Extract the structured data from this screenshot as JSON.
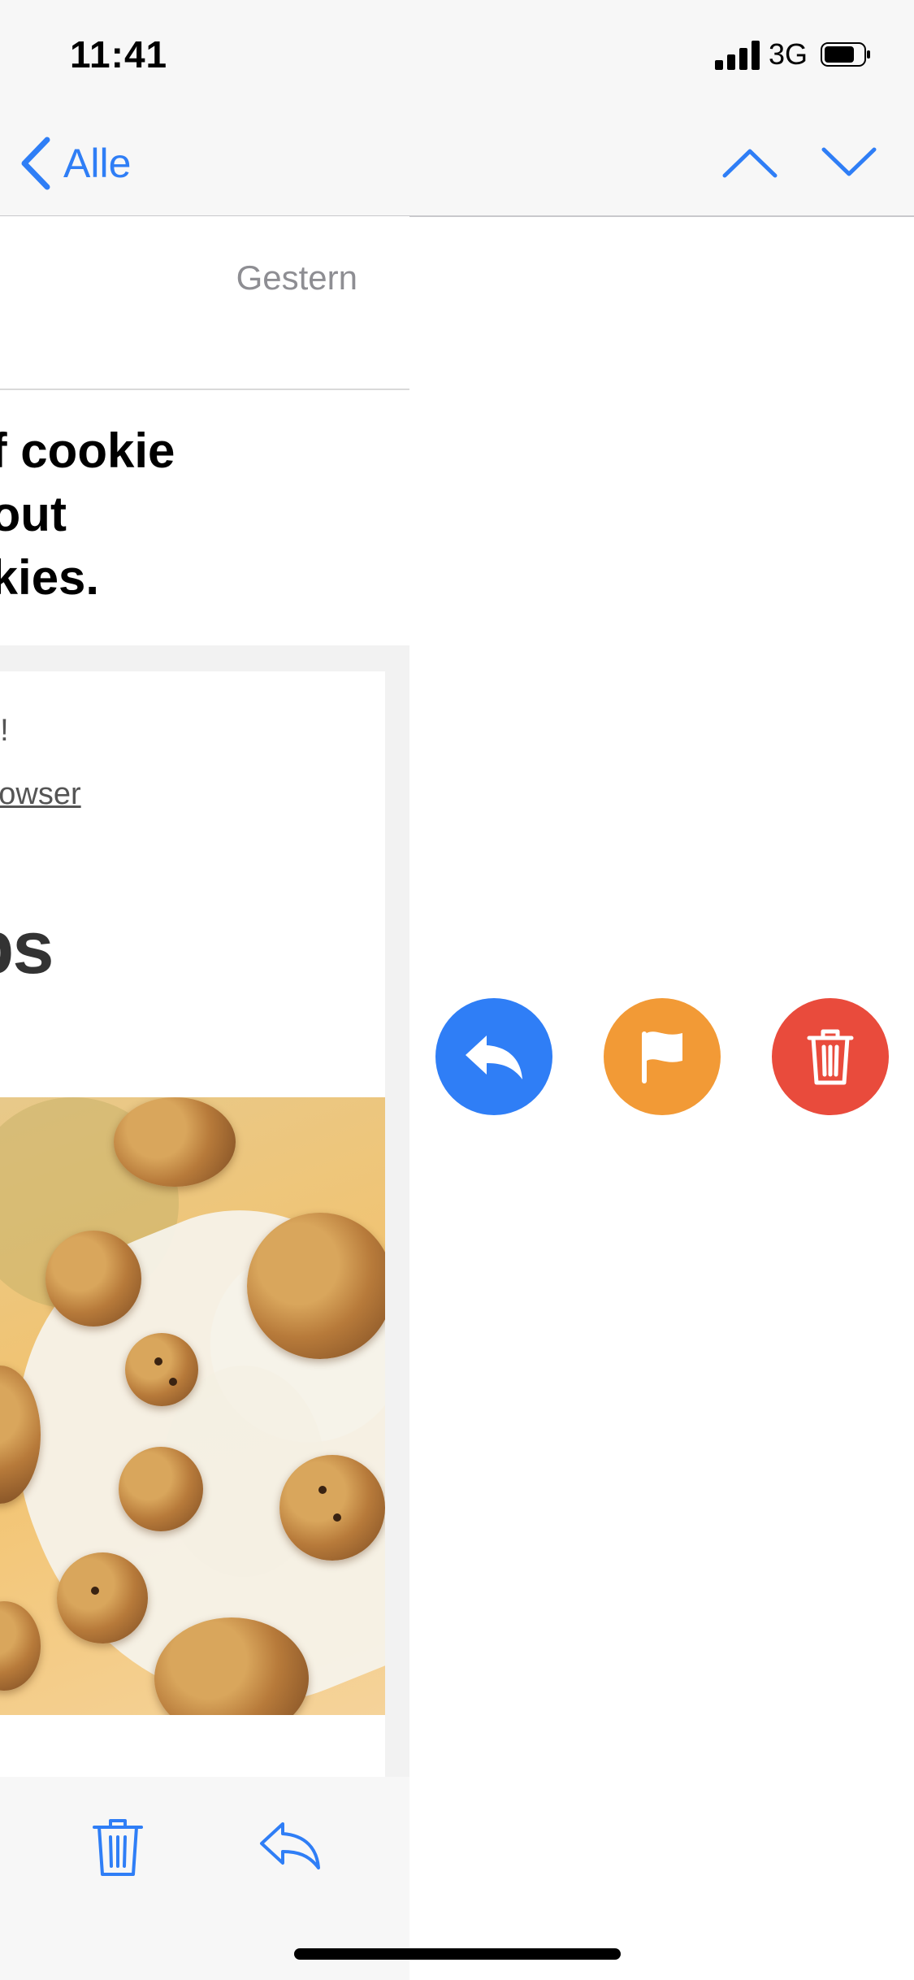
{
  "status": {
    "time": "11:41",
    "network": "3G"
  },
  "nav": {
    "back_label": "Alle"
  },
  "message": {
    "date": "Gestern",
    "subject": "of cookie\nbout\nokies.",
    "preheader": "ps!",
    "browser_link": " your browser",
    "headline": "Steps"
  },
  "colors": {
    "accent": "#2f7ef6",
    "flag": "#f29a36",
    "trash": "#e94b3c"
  },
  "icons": {
    "back": "chevron-left-icon",
    "up": "chevron-up-icon",
    "down": "chevron-down-icon",
    "trash": "trash-icon",
    "reply": "reply-icon",
    "flag": "flag-icon"
  }
}
